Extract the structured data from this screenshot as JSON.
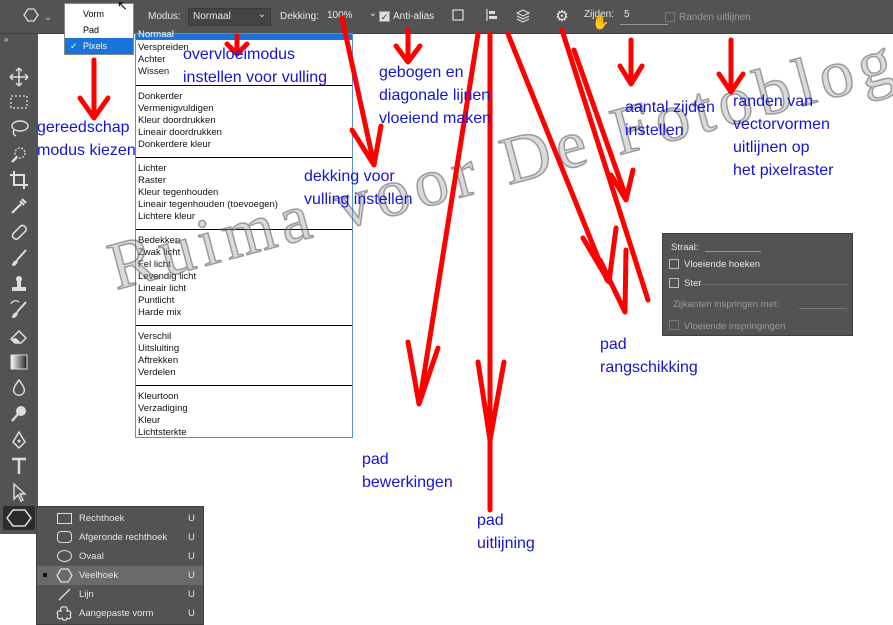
{
  "toolbar": {
    "mode_label": "Modus:",
    "mode_value": "Normaal",
    "opacity_label": "Dekking:",
    "opacity_value": "100%",
    "antialias_label": "Anti-alias",
    "sides_label": "Zijden:",
    "sides_value": "5",
    "align_edges_label": "Randen uitlijnen"
  },
  "tool_mode_dropdown": {
    "items": [
      {
        "label": "Vorm",
        "checked": false
      },
      {
        "label": "Pad",
        "checked": false
      },
      {
        "label": "Pixels",
        "checked": true
      }
    ]
  },
  "blend_modes": {
    "group1": [
      "Normaal",
      "Verspreiden",
      "Achter",
      "Wissen"
    ],
    "group2": [
      "Donkerder",
      "Vermenigvuldigen",
      "Kleur doordrukken",
      "Lineair doordrukken",
      "Donkerdere kleur"
    ],
    "group3": [
      "Lichter",
      "Raster",
      "Kleur tegenhouden",
      "Lineair tegenhouden (toevoegen)",
      "Lichtere kleur"
    ],
    "group4": [
      "Bedekken",
      "Zwak licht",
      "Fel licht",
      "Levendig licht",
      "Lineair licht",
      "Puntlicht",
      "Harde mix"
    ],
    "group5": [
      "Verschil",
      "Uitsluiting",
      "Aftrekken",
      "Verdelen"
    ],
    "group6": [
      "Kleurtoon",
      "Verzadiging",
      "Kleur",
      "Lichtsterkte"
    ]
  },
  "shape_tools": [
    {
      "label": "Rechthoek",
      "key": "U",
      "active": false
    },
    {
      "label": "Afgeronde rechthoek",
      "key": "U",
      "active": false
    },
    {
      "label": "Ovaal",
      "key": "U",
      "active": false
    },
    {
      "label": "Veelhoek",
      "key": "U",
      "active": true
    },
    {
      "label": "Lijn",
      "key": "U",
      "active": false
    },
    {
      "label": "Aangepaste vorm",
      "key": "U",
      "active": false
    }
  ],
  "polygon_options": {
    "radius_label": "Straal:",
    "smooth_corners": "Vloeiende hoeken",
    "star": "Ster",
    "indent_sides": "Zijkanten inspringen met:",
    "smooth_indents": "Vloeiende inspringingen"
  },
  "annotations": {
    "tool_mode": "gereedschap\nmodus kiezen",
    "blend_mode": "overvloeimodus\ninstellen voor vulling",
    "opacity": "dekking voor\nvulling instellen",
    "antialias": "gebogen en\ndiagonale lijnen\nvloeiend maken",
    "sides": "aantal zijden\ninstellen",
    "align_edges": "randen van\nvectorvormen\nuitlijnen op\nhet pixelraster",
    "path_ops": "pad\nbewerkingen",
    "path_align": "pad\nuitlijning",
    "path_arrange": "pad\nrangschikking"
  },
  "watermark": "Ruima voor De Fotoblogger",
  "colors": {
    "ui_bg": "#535353",
    "annotation": "#1414d6",
    "arrow": "#ff0000",
    "menu_highlight": "#1a73d9"
  }
}
